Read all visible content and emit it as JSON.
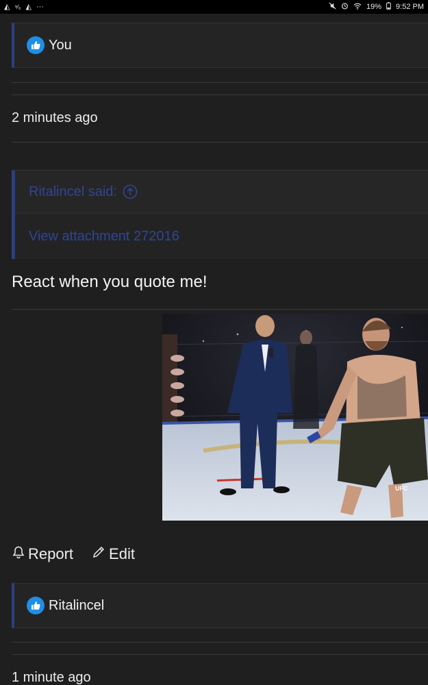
{
  "status_bar": {
    "left_icons": [
      "image-icon",
      "signal-icon",
      "image-icon",
      "more-icon"
    ],
    "right_icons": [
      "mute-icon",
      "alarm-icon",
      "wifi-icon",
      "battery-icon"
    ],
    "left_glyphs": [
      "◭",
      "⁹⁄₆",
      "◭",
      "···"
    ],
    "battery": "19%",
    "time": "9:52 PM"
  },
  "reaction_top": {
    "user": "You",
    "icon": "thumbs-up-icon"
  },
  "post": {
    "time": "2 minutes ago",
    "quote": {
      "author_said": "Ritalincel said:",
      "attachment": "View attachment 272016"
    },
    "text": "React when you quote me!",
    "actions": {
      "report": "Report",
      "edit": "Edit"
    }
  },
  "reaction_bottom": {
    "user": "Ritalincel",
    "icon": "thumbs-up-icon"
  },
  "next_post": {
    "time": "1 minute ago"
  },
  "colors": {
    "accent_border": "#2b3f82",
    "quote_text": "#2e4697",
    "like_blue": "#1f8ee8",
    "background": "#1f1f1f"
  }
}
